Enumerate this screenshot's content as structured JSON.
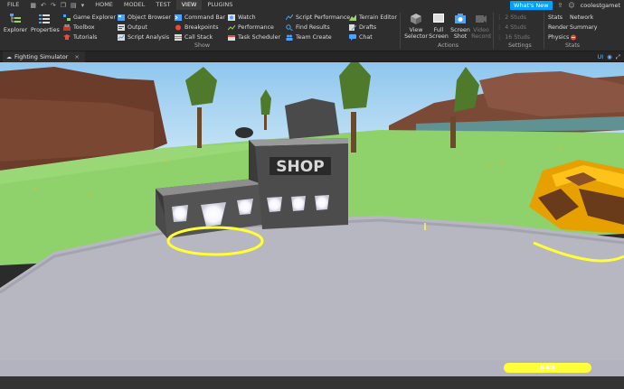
{
  "menubar": {
    "file": "FILE",
    "tabs": [
      "HOME",
      "MODEL",
      "TEST",
      "VIEW",
      "PLUGINS"
    ],
    "active_tab": "VIEW",
    "whats_new": "What's New",
    "username": "coolestgamet"
  },
  "ribbon": {
    "explorer": "Explorer",
    "properties": "Properties",
    "col1": [
      "Game Explorer",
      "Toolbox",
      "Tutorials"
    ],
    "col2": [
      "Object Browser",
      "Output",
      "Script Analysis"
    ],
    "col3": [
      "Command Bar",
      "Breakpoints",
      "Call Stack"
    ],
    "col4": [
      "Watch",
      "Performance",
      "Task Scheduler"
    ],
    "col5": [
      "Script Performance",
      "Find Results",
      "Team Create"
    ],
    "col6": [
      "Terrain Editor",
      "Drafts",
      "Chat"
    ],
    "show_label": "Show",
    "view_selector": [
      "View",
      "Selector"
    ],
    "full_screen": [
      "Full",
      "Screen"
    ],
    "screen_shot": [
      "Screen",
      "Shot"
    ],
    "video_record": [
      "Video",
      "Record"
    ],
    "actions_label": "Actions",
    "studs": [
      "2 Studs",
      "4 Studs",
      "16 Studs"
    ],
    "settings_label": "Settings",
    "stats_col1": [
      "Stats",
      "Render",
      "Physics"
    ],
    "stats_col2": [
      "Network",
      "Summary"
    ],
    "stats_label": "Stats"
  },
  "tabbar": {
    "doc_tab": "Fighting Simulator",
    "ui_label": "UI"
  },
  "scene": {
    "shop_sign": "SHOP",
    "hud_button": "NAH"
  }
}
